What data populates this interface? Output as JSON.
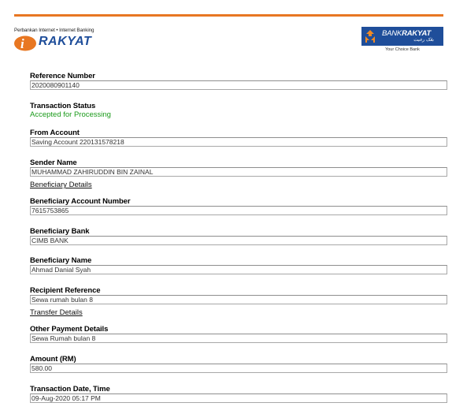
{
  "header": {
    "tagline": "Perbankan Internet • Internet Banking",
    "brand_logo_text": "RAKYAT",
    "bank_logo_prefix": "BANK",
    "bank_logo_suffix": "RAKYAT",
    "bank_logo_jawi": "بڠک رعيت",
    "bank_slogan": "Your Choice Bank",
    "accent_color": "#e87722",
    "bank_color": "#1f4e9a"
  },
  "fields": {
    "reference_number": {
      "label": "Reference Number",
      "value": "2020080901140"
    },
    "transaction_status": {
      "label": "Transaction Status",
      "value": "Accepted for Processing",
      "color": "#1a9a1a"
    },
    "from_account": {
      "label": "From Account",
      "value": "Saving Account 220131578218"
    },
    "sender_name": {
      "label": "Sender Name",
      "value": "MUHAMMAD ZAHIRUDDIN BIN ZAINAL"
    },
    "beneficiary_account_number": {
      "label": "Beneficiary Account Number",
      "value": "7615753865"
    },
    "beneficiary_bank": {
      "label": "Beneficiary Bank",
      "value": "CIMB BANK"
    },
    "beneficiary_name": {
      "label": "Beneficiary Name",
      "value": "Ahmad Danial Syah"
    },
    "recipient_reference": {
      "label": "Recipient Reference",
      "value": "Sewa rumah bulan 8"
    },
    "other_payment_details": {
      "label": "Other Payment Details",
      "value": "Sewa Rumah bulan 8"
    },
    "amount": {
      "label": "Amount (RM)",
      "value": "580.00"
    },
    "transaction_datetime": {
      "label": "Transaction Date, Time",
      "value": "09-Aug-2020 05:17 PM"
    }
  },
  "links": {
    "beneficiary_details": "Beneficiary Details",
    "transfer_details": "Transfer Details"
  }
}
